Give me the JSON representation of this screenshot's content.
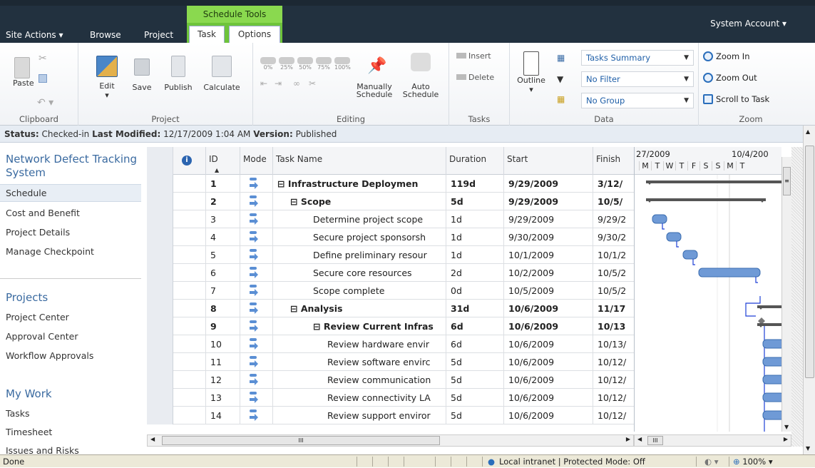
{
  "topbar": {
    "site_actions": "Site Actions ▾",
    "browse": "Browse",
    "project": "Project",
    "context_group": "Schedule Tools",
    "tab_task": "Task",
    "tab_options": "Options",
    "account": "System Account ▾"
  },
  "ribbon": {
    "clipboard": {
      "label": "Clipboard",
      "paste": "Paste"
    },
    "project": {
      "label": "Project",
      "edit": "Edit",
      "save": "Save",
      "publish": "Publish",
      "calculate": "Calculate"
    },
    "editing": {
      "label": "Editing",
      "pcts": [
        "0%",
        "25%",
        "50%",
        "75%",
        "100%"
      ],
      "manually": "Manually",
      "auto": "Auto",
      "schedule": "Schedule"
    },
    "tasks": {
      "label": "Tasks",
      "insert": "Insert",
      "delete": "Delete"
    },
    "data": {
      "label": "Data",
      "outline": "Outline",
      "view": "Tasks Summary",
      "filter": "No Filter",
      "group": "No Group"
    },
    "zoom": {
      "label": "Zoom",
      "zoom_in": "Zoom In",
      "zoom_out": "Zoom Out",
      "scroll": "Scroll to Task"
    }
  },
  "status_line": {
    "status_label": "Status:",
    "status_value": "Checked-in",
    "modified_label": "Last Modified:",
    "modified_value": "12/17/2009 1:04 AM",
    "version_label": "Version:",
    "version_value": "Published"
  },
  "leftnav": {
    "title": "Network Defect Tracking System",
    "items": [
      "Schedule",
      "Cost and Benefit",
      "Project Details",
      "Manage Checkpoint"
    ],
    "projects_heading": "Projects",
    "projects_items": [
      "Project Center",
      "Approval Center",
      "Workflow Approvals"
    ],
    "mywork_heading": "My Work",
    "mywork_items": [
      "Tasks",
      "Timesheet",
      "Issues and Risks"
    ]
  },
  "grid": {
    "columns": {
      "id": "ID",
      "mode": "Mode",
      "name": "Task Name",
      "duration": "Duration",
      "start": "Start",
      "finish": "Finish"
    },
    "rows": [
      {
        "id": "1",
        "name": "⊟ Infrastructure Deploymen",
        "duration": "119d",
        "start": "9/29/2009",
        "finish": "3/12/",
        "bold": true,
        "indent": 0
      },
      {
        "id": "2",
        "name": "⊟ Scope",
        "duration": "5d",
        "start": "9/29/2009",
        "finish": "10/5/",
        "bold": true,
        "indent": 1
      },
      {
        "id": "3",
        "name": "Determine project scope",
        "duration": "1d",
        "start": "9/29/2009",
        "finish": "9/29/2",
        "bold": false,
        "indent": 2
      },
      {
        "id": "4",
        "name": "Secure project sponsorsh",
        "duration": "1d",
        "start": "9/30/2009",
        "finish": "9/30/2",
        "bold": false,
        "indent": 2
      },
      {
        "id": "5",
        "name": "Define preliminary resour",
        "duration": "1d",
        "start": "10/1/2009",
        "finish": "10/1/2",
        "bold": false,
        "indent": 2
      },
      {
        "id": "6",
        "name": "Secure core resources",
        "duration": "2d",
        "start": "10/2/2009",
        "finish": "10/5/2",
        "bold": false,
        "indent": 2
      },
      {
        "id": "7",
        "name": "Scope complete",
        "duration": "0d",
        "start": "10/5/2009",
        "finish": "10/5/2",
        "bold": false,
        "indent": 2
      },
      {
        "id": "8",
        "name": "⊟ Analysis",
        "duration": "31d",
        "start": "10/6/2009",
        "finish": "11/17",
        "bold": true,
        "indent": 1
      },
      {
        "id": "9",
        "name": "⊟ Review Current Infras",
        "duration": "6d",
        "start": "10/6/2009",
        "finish": "10/13",
        "bold": true,
        "indent": 2
      },
      {
        "id": "10",
        "name": "Review hardware envir",
        "duration": "6d",
        "start": "10/6/2009",
        "finish": "10/13/",
        "bold": false,
        "indent": 3
      },
      {
        "id": "11",
        "name": "Review software envirc",
        "duration": "5d",
        "start": "10/6/2009",
        "finish": "10/12/",
        "bold": false,
        "indent": 3
      },
      {
        "id": "12",
        "name": "Review communication",
        "duration": "5d",
        "start": "10/6/2009",
        "finish": "10/12/",
        "bold": false,
        "indent": 3
      },
      {
        "id": "13",
        "name": "Review connectivity LA",
        "duration": "5d",
        "start": "10/6/2009",
        "finish": "10/12/",
        "bold": false,
        "indent": 3
      },
      {
        "id": "14",
        "name": "Review support enviror",
        "duration": "5d",
        "start": "10/6/2009",
        "finish": "10/12/",
        "bold": false,
        "indent": 3
      }
    ]
  },
  "gantt": {
    "week1": "27/2009",
    "week2": "10/4/200",
    "days": [
      "M",
      "T",
      "W",
      "T",
      "F",
      "S",
      "S",
      "M",
      "T"
    ],
    "scroll_mark": "III"
  },
  "hscroll_mark": "III",
  "statusbar": {
    "left": "Done",
    "zone": "Local intranet | Protected Mode: Off",
    "zoom": "100%"
  },
  "colors": {
    "topbar": "#22313f",
    "context": "#8ad94f",
    "bar": "#6f9ad6",
    "summary": "#555555",
    "link": "#1f5fa8"
  }
}
